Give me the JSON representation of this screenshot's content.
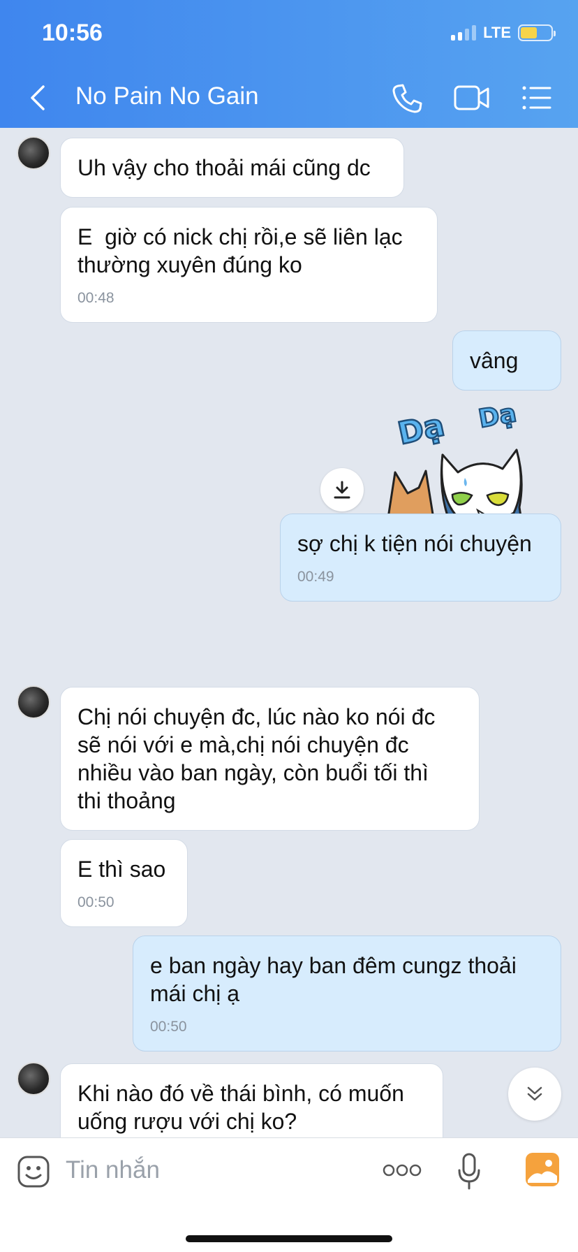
{
  "status_bar": {
    "time": "10:56",
    "network": "LTE",
    "battery_color": "#f6d44a"
  },
  "header": {
    "title": "No Pain No Gain",
    "back_icon": "chevron-left-icon",
    "call_icon": "phone-icon",
    "video_icon": "video-camera-icon",
    "menu_icon": "list-icon"
  },
  "messages": [
    {
      "side": "in",
      "text": "Uh vậy cho thoải mái cũng dc",
      "time": ""
    },
    {
      "side": "in",
      "text": "E  giờ có nick chị rồi,e sẽ liên lạc\nthường xuyên đúng ko",
      "time": "00:48"
    },
    {
      "side": "out",
      "text": "vâng",
      "time": ""
    },
    {
      "side": "out",
      "text": "sợ chị k tiện nói chuyện",
      "time": "00:49"
    },
    {
      "side": "in",
      "text": "Chị nói chuyện đc, lúc nào ko nói đc\nsẽ nói với e mà,chị nói chuyện đc\nnhiều vào ban ngày, còn buổi tối thì\nthi thoảng",
      "time": ""
    },
    {
      "side": "in",
      "text": "E thì sao",
      "time": "00:50"
    },
    {
      "side": "out",
      "text": "e ban ngày hay ban đêm cungz thoải\nmái chị ạ",
      "time": "00:50"
    },
    {
      "side": "in",
      "text": "Khi nào đó về thái bình, có muốn\nuống rượu với chị ko?",
      "time": ""
    }
  ],
  "sticker": {
    "word_left": "Dạ",
    "word_right": "Dạ"
  },
  "input": {
    "placeholder": "Tin nhắn",
    "sticker_icon": "emoji-icon",
    "more_icon": "more-dots-icon",
    "mic_icon": "microphone-icon",
    "image_icon": "image-icon"
  }
}
